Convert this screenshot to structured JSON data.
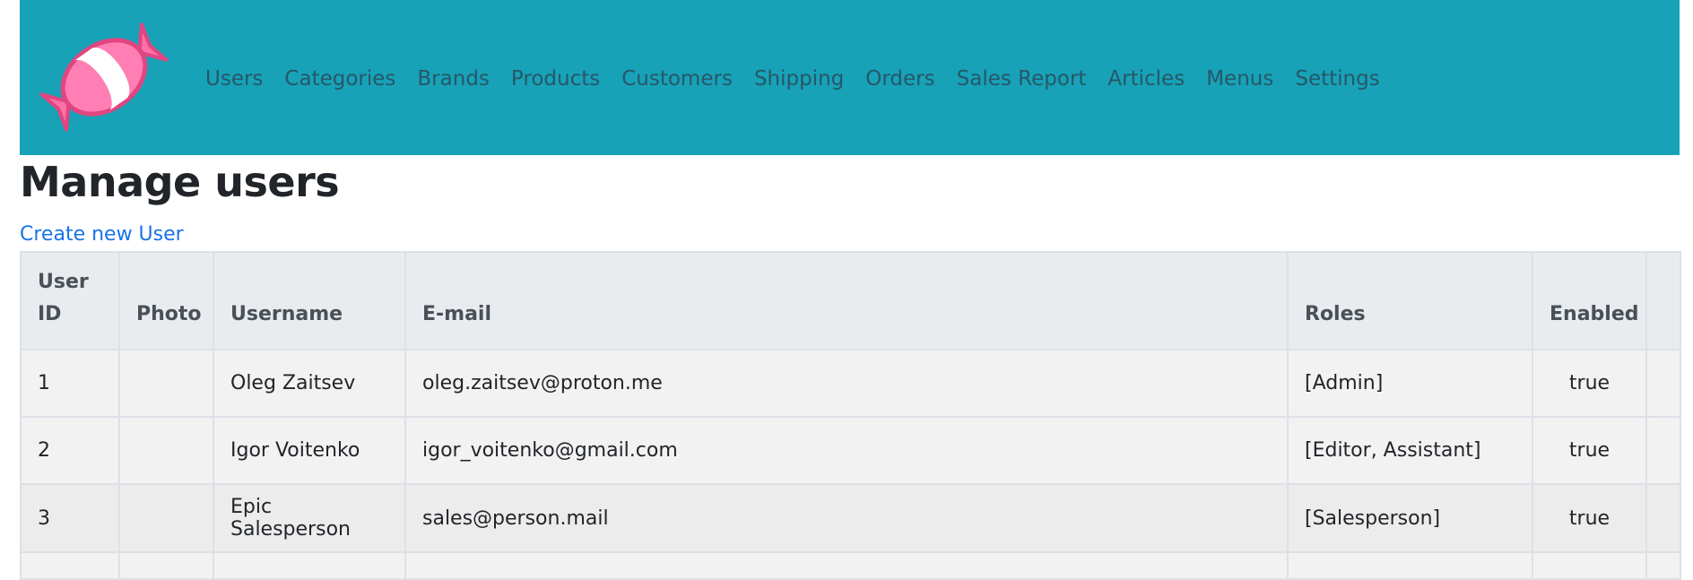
{
  "nav": {
    "logo": "candy-logo",
    "items": [
      {
        "label": "Users"
      },
      {
        "label": "Categories"
      },
      {
        "label": "Brands"
      },
      {
        "label": "Products"
      },
      {
        "label": "Customers"
      },
      {
        "label": "Shipping"
      },
      {
        "label": "Orders"
      },
      {
        "label": "Sales Report"
      },
      {
        "label": "Articles"
      },
      {
        "label": "Menus"
      },
      {
        "label": "Settings"
      }
    ]
  },
  "page": {
    "title": "Manage users",
    "create_link": "Create new User"
  },
  "table": {
    "headers": {
      "user_id": "User ID",
      "photo": "Photo",
      "username": "Username",
      "email": "E-mail",
      "roles": "Roles",
      "enabled": "Enabled",
      "actions": ""
    },
    "rows": [
      {
        "id": "1",
        "photo": "",
        "username": "Oleg Zaitsev",
        "email": "oleg.zaitsev@proton.me",
        "roles": "[Admin]",
        "enabled": "true"
      },
      {
        "id": "2",
        "photo": "",
        "username": "Igor Voitenko",
        "email": "igor_voitenko@gmail.com",
        "roles": "[Editor, Assistant]",
        "enabled": "true"
      },
      {
        "id": "3",
        "photo": "",
        "username": "Epic Salesperson",
        "email": "sales@person.mail",
        "roles": "[Salesperson]",
        "enabled": "true"
      }
    ]
  },
  "colors": {
    "navbar": "#17a2b8",
    "link": "#1a73e8",
    "header_row": "#e9ecef"
  }
}
